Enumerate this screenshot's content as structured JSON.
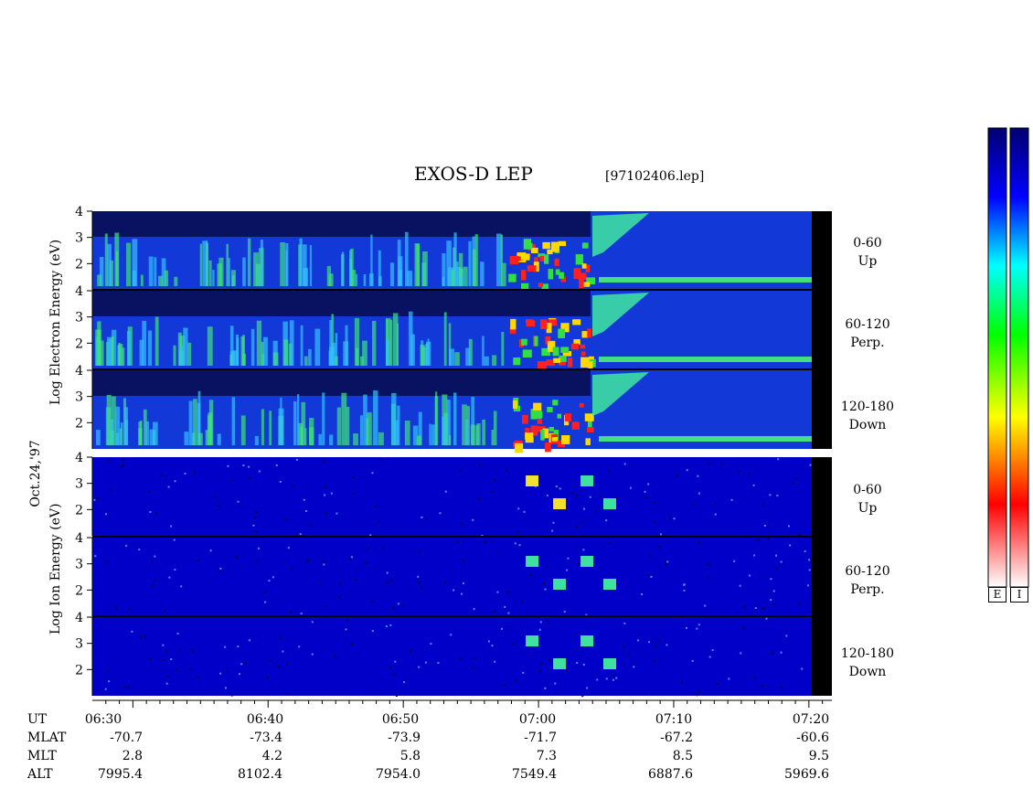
{
  "title": "EXOS-D LEP",
  "filename": "[97102406.lep]",
  "date_label": "Oct.24,'97",
  "electron_ylabel": [
    "Log",
    "Electron",
    "Energy",
    "(eV)"
  ],
  "ion_ylabel": [
    "Log",
    "Ion",
    "Energy",
    "(eV)"
  ],
  "panel_labels": [
    {
      "range": "0-60",
      "dir": "Up"
    },
    {
      "range": "60-120",
      "dir": "Perp."
    },
    {
      "range": "120-180",
      "dir": "Down"
    },
    {
      "range": "0-60",
      "dir": "Up"
    },
    {
      "range": "60-120",
      "dir": "Perp."
    },
    {
      "range": "120-180",
      "dir": "Down"
    }
  ],
  "colorbar_labels": [
    "E",
    "I"
  ],
  "colors": {
    "spectrogram_background": "#0000c8",
    "colorbar_stops": [
      "#ffffff",
      "#ff0000",
      "#ffff00",
      "#00ff00",
      "#00ffff",
      "#0000ff",
      "#000070"
    ]
  },
  "chart_data": {
    "type": "heatmap",
    "title": "EXOS-D LEP",
    "panels": [
      {
        "species": "Electron",
        "pitch_angle": "0-60",
        "direction": "Up"
      },
      {
        "species": "Electron",
        "pitch_angle": "60-120",
        "direction": "Perp."
      },
      {
        "species": "Electron",
        "pitch_angle": "120-180",
        "direction": "Down"
      },
      {
        "species": "Ion",
        "pitch_angle": "0-60",
        "direction": "Up"
      },
      {
        "species": "Ion",
        "pitch_angle": "60-120",
        "direction": "Perp."
      },
      {
        "species": "Ion",
        "pitch_angle": "120-180",
        "direction": "Down"
      }
    ],
    "ylim": [
      1,
      4
    ],
    "y_ticks": [
      "4",
      "3",
      "2"
    ],
    "xlim_minutes": [
      27,
      81.7
    ],
    "x_tick_minutes": [
      30,
      40,
      50,
      60,
      70,
      80
    ],
    "rows": [
      {
        "name": "UT",
        "values": [
          "06:30",
          "06:40",
          "06:50",
          "07:00",
          "07:10",
          "07:20"
        ]
      },
      {
        "name": "MLAT",
        "values": [
          "-70.7",
          "-73.4",
          "-73.9",
          "-71.7",
          "-67.2",
          "-60.6"
        ]
      },
      {
        "name": "MLT",
        "values": [
          "2.8",
          "4.2",
          "5.8",
          "7.3",
          "8.5",
          "9.5"
        ]
      },
      {
        "name": "ALT",
        "values": [
          "7995.4",
          "8102.4",
          "7954.0",
          "7549.4",
          "6887.6",
          "5969.6"
        ]
      }
    ]
  }
}
